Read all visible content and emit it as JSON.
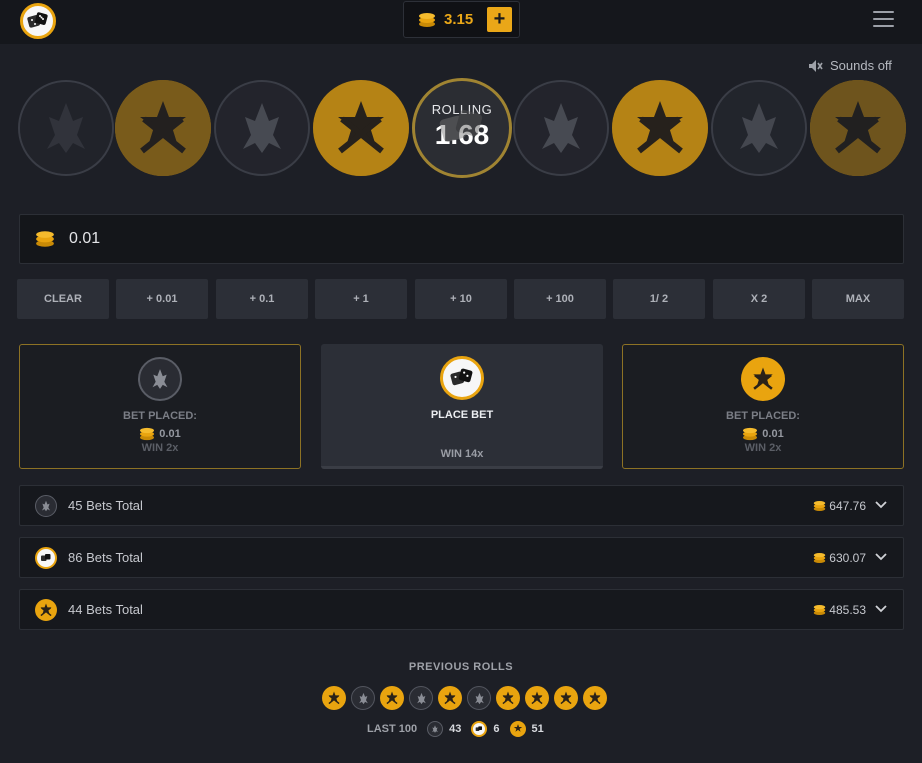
{
  "header": {
    "logo_icon": "dice-icon",
    "balance": "3.15",
    "add_label": "+",
    "menu_icon": "hamburger-icon"
  },
  "sounds": {
    "label": "Sounds off",
    "icon": "speaker-muted-icon"
  },
  "roller": {
    "label": "ROLLING",
    "value": "1.68",
    "sequence": [
      "ct",
      "t",
      "ct",
      "t",
      "dice",
      "ct",
      "t",
      "ct",
      "t"
    ]
  },
  "bet_input": {
    "value": "0.01",
    "icon": "coins-icon"
  },
  "quick_buttons": [
    "CLEAR",
    "+ 0.01",
    "+ 0.1",
    "+ 1",
    "+ 10",
    "+ 100",
    "1/ 2",
    "X 2",
    "MAX"
  ],
  "panels": [
    {
      "side": "ct",
      "title": "BET PLACED:",
      "amount": "0.01",
      "win": "WIN 2x"
    },
    {
      "side": "dice",
      "title": "PLACE BET",
      "win": "WIN 14x"
    },
    {
      "side": "t",
      "title": "BET PLACED:",
      "amount": "0.01",
      "win": "WIN 2x"
    }
  ],
  "totals": [
    {
      "side": "ct",
      "label": "45 Bets Total",
      "amount": "647.76"
    },
    {
      "side": "dice",
      "label": "86 Bets Total",
      "amount": "630.07"
    },
    {
      "side": "t",
      "label": "44 Bets Total",
      "amount": "485.53"
    }
  ],
  "previous": {
    "title": "PREVIOUS ROLLS",
    "rolls": [
      "t",
      "ct",
      "t",
      "ct",
      "t",
      "ct",
      "t",
      "t",
      "t",
      "t"
    ],
    "last_label": "LAST 100",
    "counts": {
      "ct": "43",
      "dice": "6",
      "t": "51"
    }
  },
  "colors": {
    "accent": "#e9a40f",
    "background": "#1d1f26",
    "panel": "#2c2f37"
  }
}
